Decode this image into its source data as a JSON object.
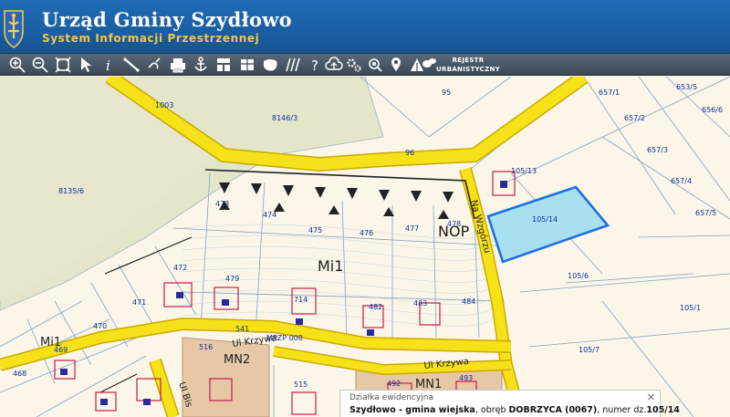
{
  "header": {
    "title": "Urząd Gminy Szydłowo",
    "subtitle": "System Informacji Przestrzennej"
  },
  "toolbar": {
    "tools": [
      "zoom-in-icon",
      "zoom-out-icon",
      "zoom-extent-icon",
      "select-arrow-icon",
      "info-icon",
      "measure-ruler-icon",
      "link-chain-icon",
      "print-icon",
      "anchor-icon",
      "layout-icon",
      "layers-panel-icon",
      "area-shape-icon",
      "hatch-icon",
      "help-icon",
      "cloud-upload-icon",
      "settings-gears-icon",
      "search-zoom-icon",
      "location-pin-icon",
      "triangle-ruler-icon",
      "chat-bubbles-icon"
    ],
    "registry_label_line1": "REJESTR",
    "registry_label_line2": "URBANISTYCZNY"
  },
  "map": {
    "parcels": [
      "95",
      "1003",
      "8146/3",
      "96",
      "8135/6",
      "105/13",
      "105/14",
      "105/6",
      "105/1",
      "105/7",
      "657/1",
      "653/5",
      "657/2",
      "656/6",
      "657/3",
      "657/4",
      "657/5",
      "472",
      "473",
      "474",
      "475",
      "476",
      "477",
      "478",
      "479",
      "471",
      "470",
      "469",
      "468",
      "714",
      "482",
      "483",
      "484",
      "541",
      "516",
      "492",
      "493",
      "515",
      "MPZP 008"
    ],
    "zones": [
      "Mi1",
      "Mi1",
      "MN2",
      "MN1",
      "NOP"
    ],
    "roads": [
      "Ul Krzywa",
      "Ul Krzywa",
      "Na Wzgórzu",
      "Ul Bis"
    ],
    "selected_parcel": "105/14"
  },
  "info_panel": {
    "title": "Działka ewidencyjna",
    "place": "Szydłowo - gmina wiejska",
    "sep1": ", obręb ",
    "precinct": "DOBRZYCA (0067)",
    "sep2": ", numer dz.",
    "parcel": "105/14",
    "close_symbol": "✕"
  },
  "colors": {
    "header": "#1a5ea3",
    "subtitle": "#f4c842",
    "road": "#f7e21a",
    "forest": "#e3e6c9",
    "zone_mn": "#e6c8a6",
    "selected_fill": "#a9e0ef",
    "selected_stroke": "#1e6fe0"
  }
}
